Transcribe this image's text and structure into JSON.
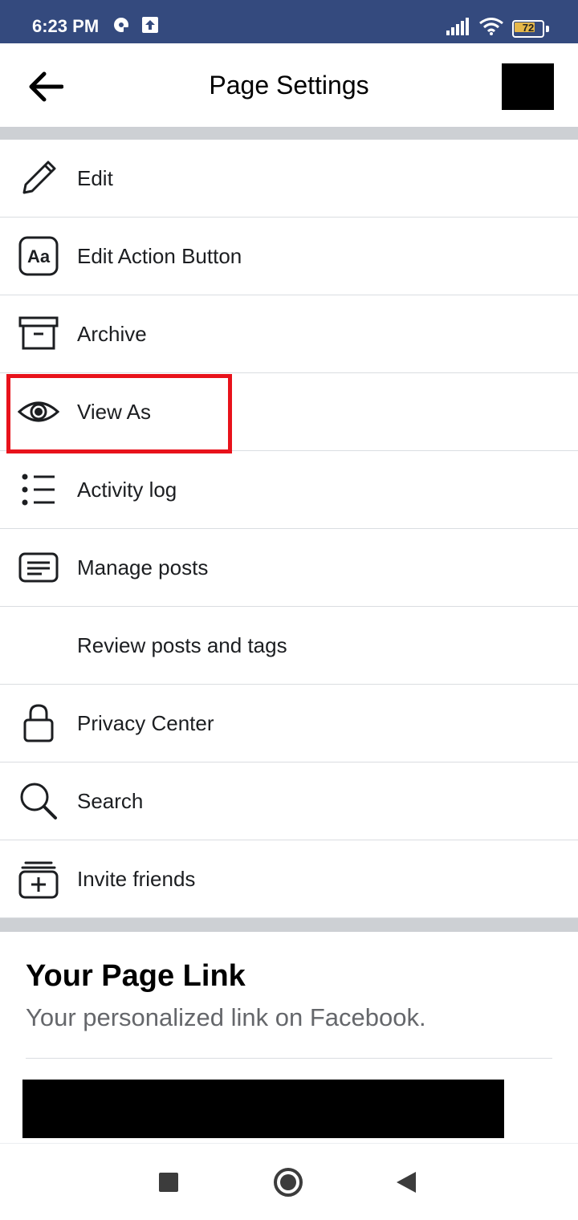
{
  "status_bar": {
    "time": "6:23 PM",
    "battery_level": "72",
    "icons": [
      "cd-icon",
      "upload-icon",
      "signal-icon",
      "wifi-icon",
      "battery-icon"
    ],
    "background": "#344a7e"
  },
  "header": {
    "title": "Page Settings",
    "back_icon": "arrow-left-icon"
  },
  "menu": {
    "items": [
      {
        "label": "Edit",
        "icon": "pencil-icon"
      },
      {
        "label": "Edit Action Button",
        "icon": "text-aa-icon"
      },
      {
        "label": "Archive",
        "icon": "archive-box-icon"
      },
      {
        "label": "View As",
        "icon": "eye-icon"
      },
      {
        "label": "Activity log",
        "icon": "list-icon"
      },
      {
        "label": "Manage posts",
        "icon": "document-lines-icon"
      },
      {
        "label": "Review posts and tags",
        "icon": ""
      },
      {
        "label": "Privacy Center",
        "icon": "lock-icon"
      },
      {
        "label": "Search",
        "icon": "search-icon"
      },
      {
        "label": "Invite friends",
        "icon": "invite-stack-icon"
      }
    ]
  },
  "page_link": {
    "title": "Your Page Link",
    "subtitle": "Your personalized link on Facebook."
  },
  "nav_bar": {
    "buttons": [
      "recents-square-icon",
      "home-circle-icon",
      "back-triangle-icon"
    ]
  },
  "colors": {
    "highlight": "#e8121b",
    "divider": "#cdd0d4",
    "text_secondary": "#65676b"
  }
}
